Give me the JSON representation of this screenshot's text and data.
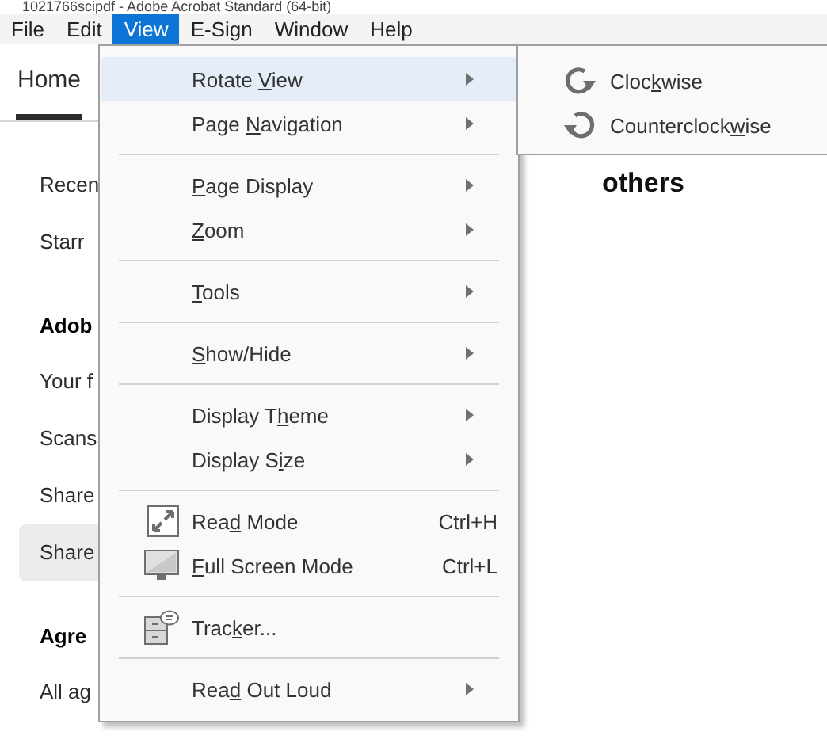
{
  "window": {
    "title": "1021766scipdf - Adobe Acrobat Standard (64-bit)"
  },
  "menu_bar": [
    {
      "label": "File",
      "selected": false
    },
    {
      "label": "Edit",
      "selected": false
    },
    {
      "label": "View",
      "selected": true
    },
    {
      "label": "E-Sign",
      "selected": false
    },
    {
      "label": "Window",
      "selected": false
    },
    {
      "label": "Help",
      "selected": false
    }
  ],
  "home_tab": {
    "label": "Home",
    "selected": true
  },
  "sidebar": {
    "items": [
      {
        "kind": "link",
        "label": "Recen",
        "selected": false
      },
      {
        "kind": "link",
        "label": "Starr",
        "selected": false
      },
      {
        "kind": "heading",
        "label": "Adob"
      },
      {
        "kind": "link",
        "label": "Your f",
        "selected": false
      },
      {
        "kind": "link",
        "label": "Scans",
        "selected": false
      },
      {
        "kind": "link",
        "label": "Share",
        "selected": false
      },
      {
        "kind": "link",
        "label": "Share",
        "selected": true
      },
      {
        "kind": "heading",
        "label": "Agre"
      },
      {
        "kind": "link",
        "label": "All ag",
        "selected": false
      }
    ]
  },
  "main_heading": "others",
  "view_menu": {
    "items": [
      {
        "kind": "submenu",
        "label": "Rotate View",
        "selected": true
      },
      {
        "kind": "submenu",
        "label": "Page Navigation",
        "selected": false
      },
      {
        "kind": "separator"
      },
      {
        "kind": "submenu",
        "label": "Page Display",
        "selected": false
      },
      {
        "kind": "submenu",
        "label": "Zoom",
        "selected": false
      },
      {
        "kind": "separator"
      },
      {
        "kind": "submenu",
        "label": "Tools",
        "selected": false
      },
      {
        "kind": "separator"
      },
      {
        "kind": "submenu",
        "label": "Show/Hide",
        "selected": false
      },
      {
        "kind": "separator"
      },
      {
        "kind": "submenu",
        "label": "Display Theme",
        "selected": false
      },
      {
        "kind": "submenu",
        "label": "Display Size",
        "selected": false
      },
      {
        "kind": "separator"
      },
      {
        "kind": "command",
        "label": "Read Mode",
        "shortcut": "Ctrl+H",
        "selected": false
      },
      {
        "kind": "command",
        "label": "Full Screen Mode",
        "shortcut": "Ctrl+L",
        "selected": false
      },
      {
        "kind": "separator"
      },
      {
        "kind": "command",
        "label": "Tracker...",
        "selected": false
      },
      {
        "kind": "separator"
      },
      {
        "kind": "submenu",
        "label": "Read Out Loud",
        "selected": false
      }
    ]
  },
  "rotate_submenu": {
    "items": [
      {
        "label": "Clockwise",
        "selected": false
      },
      {
        "label": "Counterclockwise",
        "selected": false
      }
    ]
  }
}
